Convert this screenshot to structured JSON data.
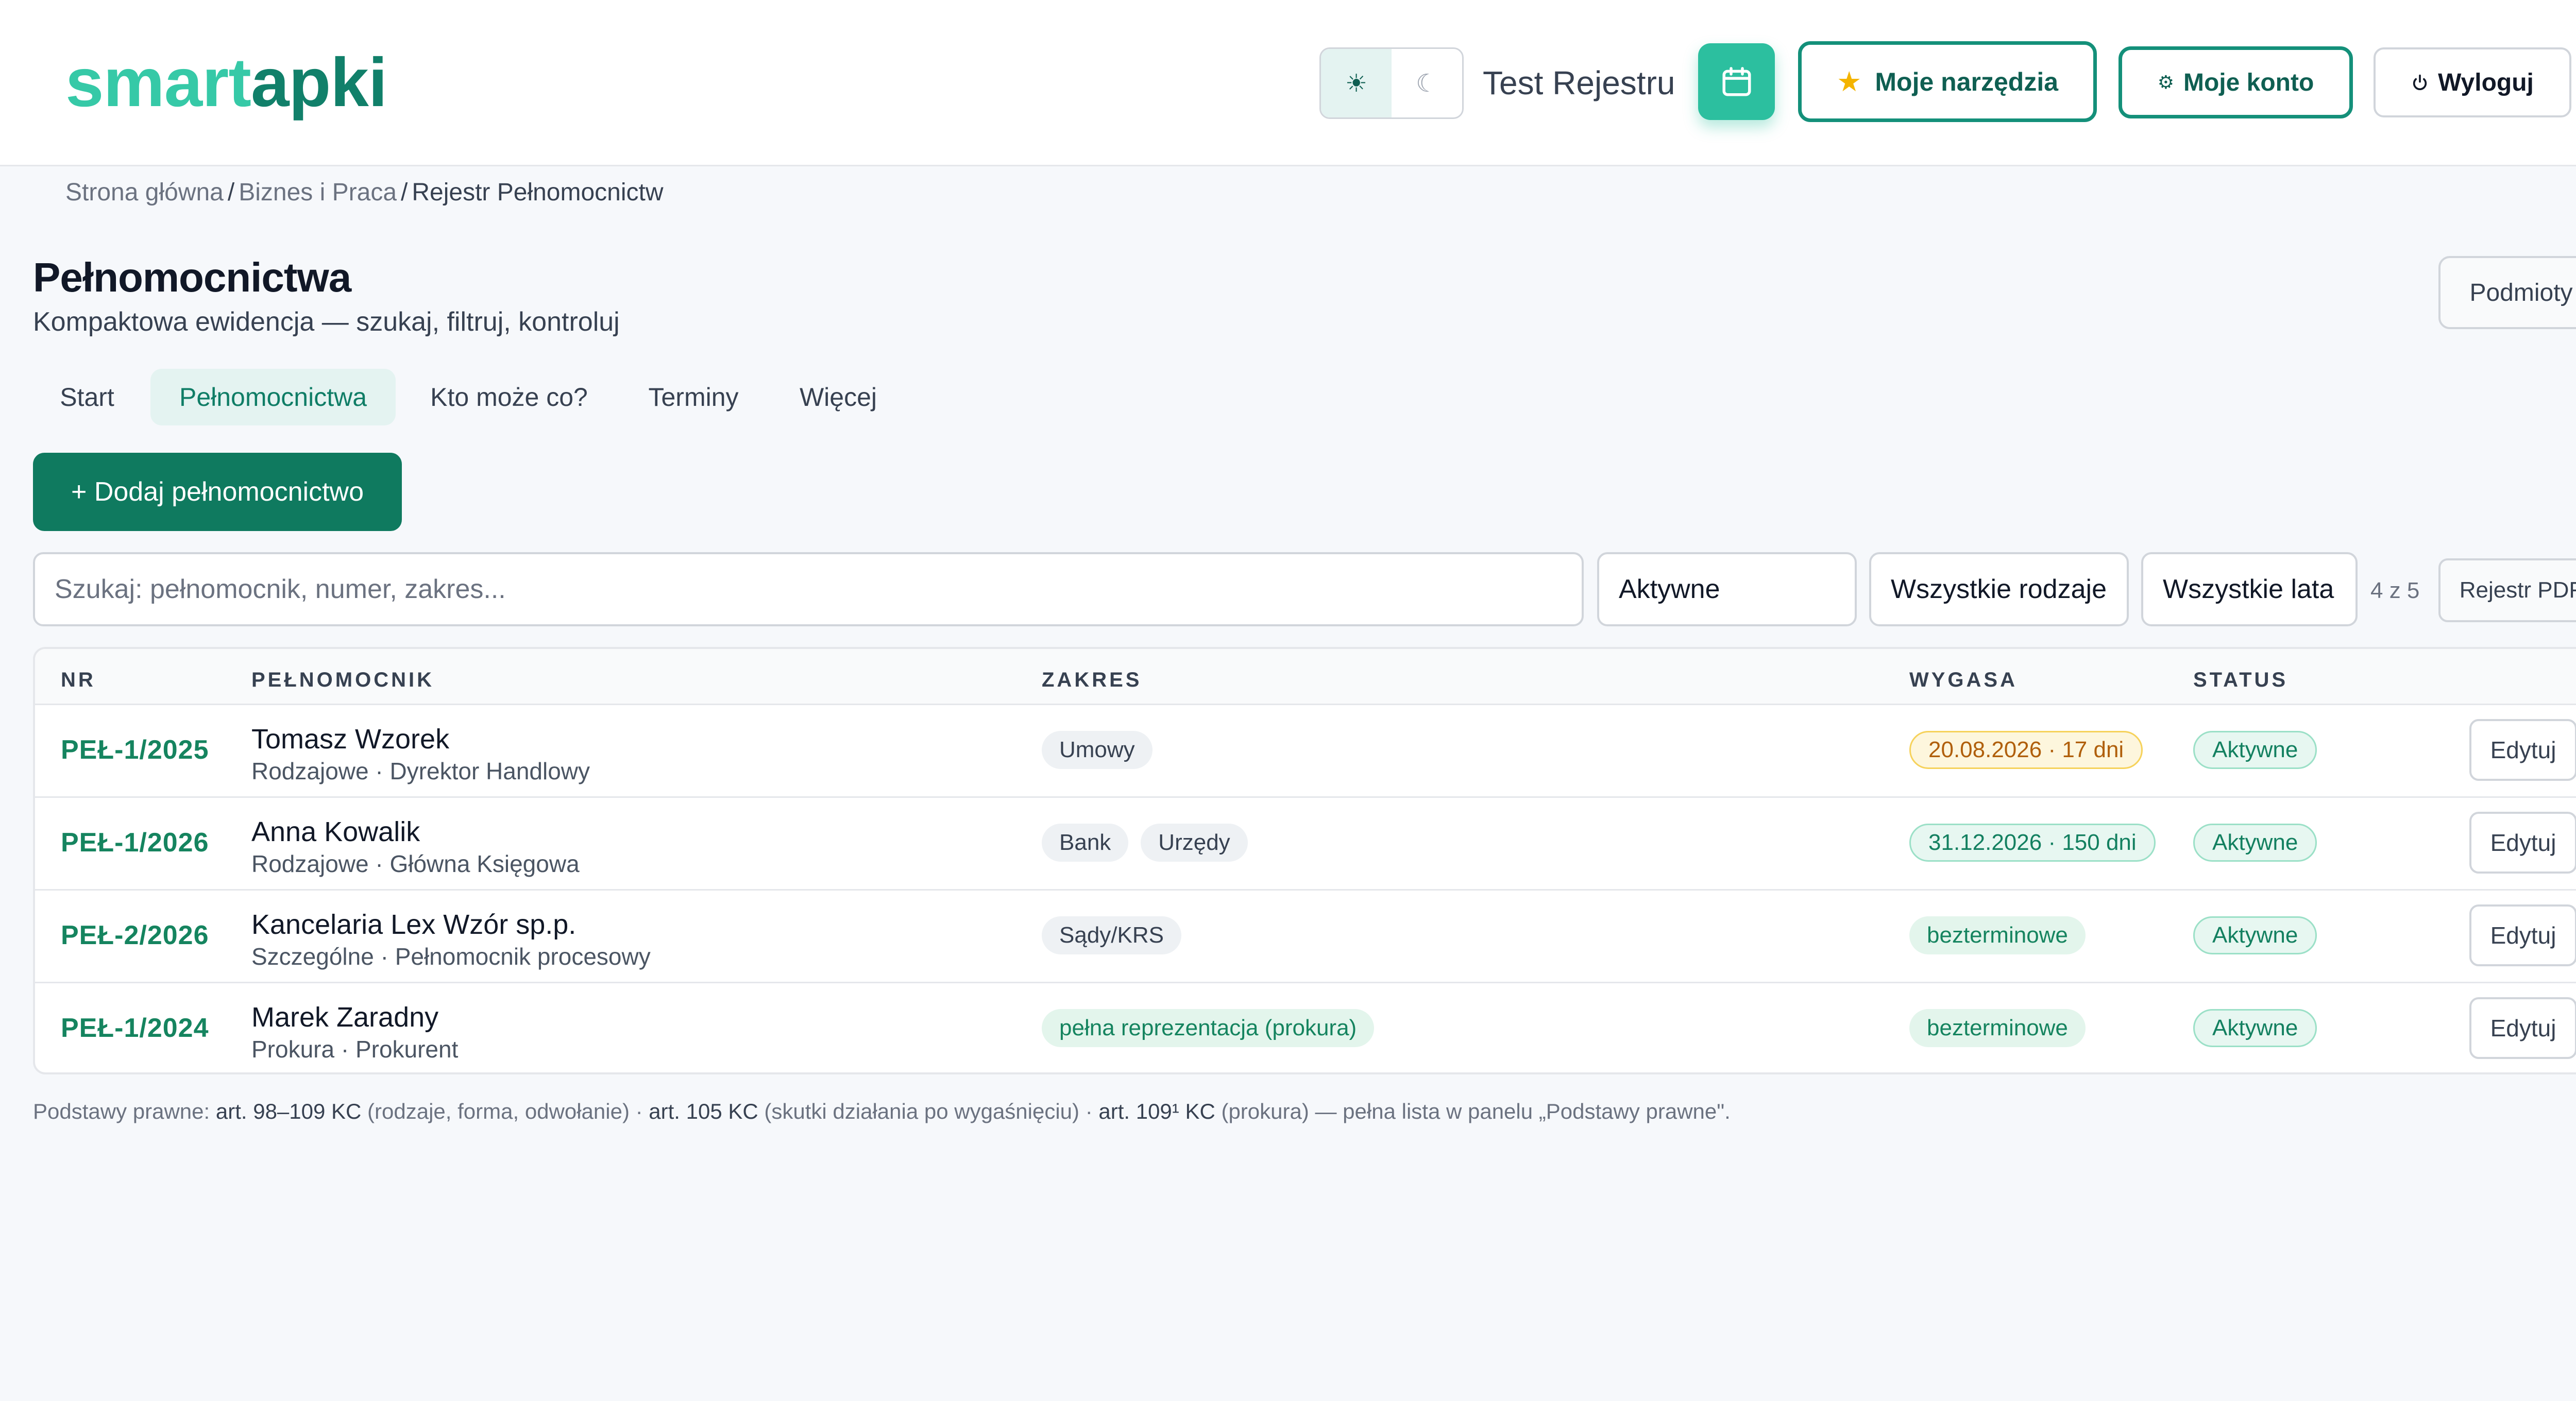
{
  "logo": {
    "part1": "smart",
    "part2": "apki"
  },
  "header": {
    "theme_light_icon": "☀",
    "theme_dark_icon": "☾",
    "company": "Test Rejestru",
    "tools_label": "Moje narzędzia",
    "account_label": "Moje konto",
    "logout_label": "Wyloguj",
    "accent_color": "#2cbf9f"
  },
  "breadcrumb": {
    "items": [
      "Strona główna",
      "Biznes i Praca",
      "Rejestr Pełnomocnictw"
    ]
  },
  "page": {
    "title": "Pełnomocnictwa",
    "subtitle": "Kompaktowa ewidencja — szukaj, filtruj, kontroluj",
    "podmioty_label": "Podmioty"
  },
  "tabs": [
    {
      "label": "Start",
      "active": false
    },
    {
      "label": "Pełnomocnictwa",
      "active": true
    },
    {
      "label": "Kto może co?",
      "active": false
    },
    {
      "label": "Terminy",
      "active": false
    },
    {
      "label": "Więcej",
      "active": false
    }
  ],
  "add_button": "+ Dodaj pełnomocnictwo",
  "filters": {
    "search_placeholder": "Szukaj: pełnomocnik, numer, zakres...",
    "search_value": "",
    "status": "Aktywne",
    "kind": "Wszystkie rodzaje",
    "year": "Wszystkie lata",
    "count": "4 z 5",
    "pdf_label": "Rejestr PDF"
  },
  "table": {
    "headers": {
      "nr": "NR",
      "pelnomocnik": "PEŁNOMOCNIK",
      "zakres": "ZAKRES",
      "wygasa": "WYGASA",
      "status": "STATUS"
    },
    "edit_label": "Edytuj",
    "rows": [
      {
        "nr": "PEŁ-1/2025",
        "name": "Tomasz Wzorek",
        "sub": "Rodzajowe · Dyrektor Handlowy",
        "scope": [
          "Umowy"
        ],
        "expires": "20.08.2026 · 17 dni",
        "expires_style": "warn",
        "status": "Aktywne"
      },
      {
        "nr": "PEŁ-1/2026",
        "name": "Anna Kowalik",
        "sub": "Rodzajowe · Główna Księgowa",
        "scope": [
          "Bank",
          "Urzędy"
        ],
        "expires": "31.12.2026 · 150 dni",
        "expires_style": "ok",
        "status": "Aktywne"
      },
      {
        "nr": "PEŁ-2/2026",
        "name": "Kancelaria Lex Wzór sp.p.",
        "sub": "Szczególne · Pełnomocnik procesowy",
        "scope": [
          "Sądy/KRS"
        ],
        "expires": "bezterminowe",
        "expires_style": "plain",
        "status": "Aktywne"
      },
      {
        "nr": "PEŁ-1/2024",
        "name": "Marek Zaradny",
        "sub": "Prokura · Prokurent",
        "scope": [
          "pełna reprezentacja (prokura)"
        ],
        "scope_style": "green",
        "expires": "bezterminowe",
        "expires_style": "plain",
        "status": "Aktywne"
      }
    ]
  },
  "footnote": {
    "prefix": "Podstawy prawne: ",
    "ref1": "art. 98–109 KC",
    "desc1": " (rodzaje, forma, odwołanie) · ",
    "ref2": "art. 105 KC",
    "desc2": " (skutki działania po wygaśnięciu) · ",
    "ref3": "art. 109¹ KC",
    "desc3": " (prokura) — pełna lista w panelu „Podstawy prawne\"."
  }
}
